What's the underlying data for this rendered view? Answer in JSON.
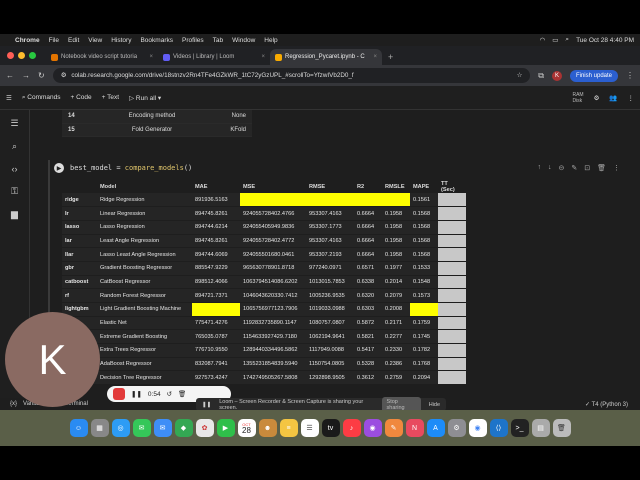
{
  "menubar": {
    "app": "Chrome",
    "items": [
      "File",
      "Edit",
      "View",
      "History",
      "Bookmarks",
      "Profiles",
      "Tab",
      "Window",
      "Help"
    ],
    "datetime": "Tue Oct 28  4:40 PM"
  },
  "tabs": [
    {
      "title": "Notebook video script tutoria",
      "color": "#e37400"
    },
    {
      "title": "Videos | Library | Loom",
      "color": "#625df5"
    },
    {
      "title": "Regression_Pycaret.ipynb - C",
      "color": "#f9ab00"
    }
  ],
  "address": {
    "url": "colab.research.google.com/drive/18stnzv2Rn4TFe4GZkWR_1tC72yGzUPL_#scrollTo=YfzwIVb2D0_f",
    "update_label": "Finish update",
    "profile_initial": "K"
  },
  "colab": {
    "commands": "Commands",
    "code": "+ Code",
    "text": "+ Text",
    "run_all": "Run all",
    "ram": "RAM",
    "disk": "Disk"
  },
  "setup_rows": [
    {
      "idx": "14",
      "desc": "Encoding method",
      "val": "None"
    },
    {
      "idx": "15",
      "desc": "Fold Generator",
      "val": "KFold"
    }
  ],
  "cell": {
    "code_prefix": "best_model = ",
    "code_fn": "compare_models",
    "code_suffix": "()"
  },
  "results": {
    "headers": [
      "",
      "Model",
      "MAE",
      "MSE",
      "RMSE",
      "R2",
      "RMSLE",
      "MAPE",
      "TT (Sec)"
    ],
    "rows": [
      {
        "key": "ridge",
        "model": "Ridge Regression",
        "mae": "891936.5163",
        "mse": "",
        "rmse": "",
        "r2": "",
        "rmsle": "",
        "mape": "0.1561",
        "hl": [
          "mse",
          "rmse",
          "r2",
          "rmsle"
        ]
      },
      {
        "key": "lr",
        "model": "Linear Regression",
        "mae": "894745.8261",
        "mse": "924055728402.4766",
        "rmse": "953307.4163",
        "r2": "0.6664",
        "rmsle": "0.1958",
        "mape": "0.1568",
        "hl": []
      },
      {
        "key": "lasso",
        "model": "Lasso Regression",
        "mae": "894744.6214",
        "mse": "924055405949.9836",
        "rmse": "953307.1773",
        "r2": "0.6664",
        "rmsle": "0.1958",
        "mape": "0.1568",
        "hl": []
      },
      {
        "key": "lar",
        "model": "Least Angle Regression",
        "mae": "894745.8261",
        "mse": "924055728402.4772",
        "rmse": "953307.4163",
        "r2": "0.6664",
        "rmsle": "0.1958",
        "mape": "0.1568",
        "hl": []
      },
      {
        "key": "llar",
        "model": "Lasso Least Angle Regression",
        "mae": "894744.6069",
        "mse": "924055501680.0461",
        "rmse": "953307.2193",
        "r2": "0.6664",
        "rmsle": "0.1958",
        "mape": "0.1568",
        "hl": []
      },
      {
        "key": "gbr",
        "model": "Gradient Boosting Regressor",
        "mae": "885547.9229",
        "mse": "965630778901.8718",
        "rmse": "977240.0971",
        "r2": "0.6571",
        "rmsle": "0.1977",
        "mape": "0.1533",
        "hl": []
      },
      {
        "key": "catboost",
        "model": "CatBoost Regressor",
        "mae": "898512.4066",
        "mse": "1063794514086.6202",
        "rmse": "1013015.7853",
        "r2": "0.6338",
        "rmsle": "0.2014",
        "mape": "0.1548",
        "hl": []
      },
      {
        "key": "rf",
        "model": "Random Forest Regressor",
        "mae": "894721.7371",
        "mse": "1046043620330.7412",
        "rmse": "1005236.9535",
        "r2": "0.6320",
        "rmsle": "0.2079",
        "mape": "0.1573",
        "hl": []
      },
      {
        "key": "lightgbm",
        "model": "Light Gradient Boosting Machine",
        "mae": "",
        "mse": "1065756977123.7906",
        "rmse": "1019033.0988",
        "r2": "0.6303",
        "rmsle": "0.2008",
        "mape": "",
        "hl": [
          "mae",
          "mape"
        ]
      },
      {
        "key": "en",
        "model": "Elastic Net",
        "mae": "775471.4276",
        "mse": "1192832735890.1147",
        "rmse": "1080757.0807",
        "r2": "0.5872",
        "rmsle": "0.2171",
        "mape": "0.1759",
        "hl": []
      },
      {
        "key": "et",
        "model": "Extreme Gradient Boosting",
        "mae": "765035.0787",
        "mse": "1154633927429.7180",
        "rmse": "1062194.9641",
        "r2": "0.5821",
        "rmsle": "0.2277",
        "mape": "0.1745",
        "hl": []
      },
      {
        "key": "et",
        "model": "Extra Trees Regressor",
        "mae": "776710.9550",
        "mse": "1289440334496.5862",
        "rmse": "1117949.0088",
        "r2": "0.5417",
        "rmsle": "0.2330",
        "mape": "0.1782",
        "hl": []
      },
      {
        "key": "ada",
        "model": "AdaBoost Regressor",
        "mae": "832087.7941",
        "mse": "1355231854839.5940",
        "rmse": "1150754.0805",
        "r2": "0.5328",
        "rmsle": "0.2386",
        "mape": "0.1768",
        "hl": []
      },
      {
        "key": "dt",
        "model": "Decision Tree Regressor",
        "mae": "927573.4247",
        "mse": "1742749505267.5808",
        "rmse": "1292898.9505",
        "r2": "0.3612",
        "rmsle": "0.2759",
        "mape": "0.2094",
        "hl": []
      }
    ]
  },
  "loom": {
    "avatar_letter": "K",
    "timer": "0:54",
    "sharing_text": "Loom – Screen Recorder & Screen Capture is sharing your screen.",
    "stop_label": "Stop sharing",
    "hide_label": "Hide"
  },
  "status": {
    "variables": "Variables",
    "terminal": "Terminal",
    "runtime": "T4 (Python 3)"
  },
  "dock": {
    "calendar_day": "28",
    "calendar_month": "OCT"
  }
}
